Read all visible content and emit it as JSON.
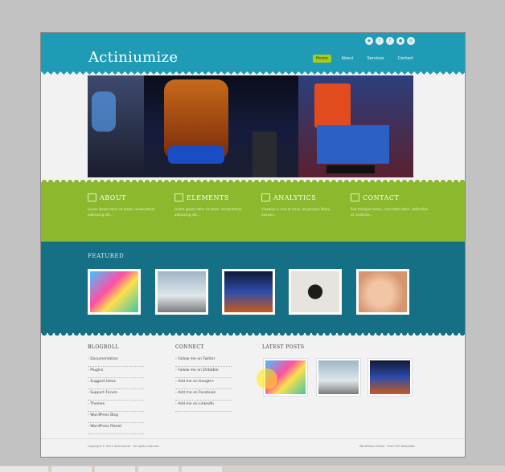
{
  "site": {
    "title": "Actiniumize"
  },
  "social_icons": [
    "rss-icon",
    "twitter-icon",
    "facebook-icon",
    "flickr-icon",
    "feed-icon"
  ],
  "nav": [
    {
      "label": "Home",
      "active": true
    },
    {
      "label": "About",
      "active": false
    },
    {
      "label": "Services",
      "active": false
    },
    {
      "label": "Contact",
      "active": false
    }
  ],
  "features": [
    {
      "title": "ABOUT",
      "icon": "envelope-icon",
      "text": "Lorem ipsum dolor sit amet, consectetuer adipiscing elit..."
    },
    {
      "title": "ELEMENTS",
      "icon": "user-icon",
      "text": "Lorem ipsum dolor sit amet, consectetuer adipiscing elit..."
    },
    {
      "title": "ANALYTICS",
      "icon": "pin-icon",
      "text": "Vivamus in erat at lacus, et pulvinar libero, aenean..."
    },
    {
      "title": "CONTACT",
      "icon": "tag-icon",
      "text": "Sed tristique lectus, risus diam dolor, defendum et, molestie..."
    }
  ],
  "featured": {
    "title": "FEATURED"
  },
  "blogroll": {
    "title": "BLOGROLL",
    "items": [
      "Documentation",
      "Plugins",
      "Suggest Ideas",
      "Support Forum",
      "Themes",
      "WordPress Blog",
      "WordPress Planet"
    ]
  },
  "connect": {
    "title": "CONNECT",
    "items": [
      "Follow me on Twitter",
      "Follow me on Dribbble",
      "Add me on Google+",
      "Add me on Facebook",
      "Add me on LinkedIn"
    ]
  },
  "latest": {
    "title": "LATEST POSTS"
  },
  "footer": {
    "left": "Copyright © 2011 Actiniumize · All rights reserved",
    "right": "WordPress Theme · Free CSS Templates"
  }
}
